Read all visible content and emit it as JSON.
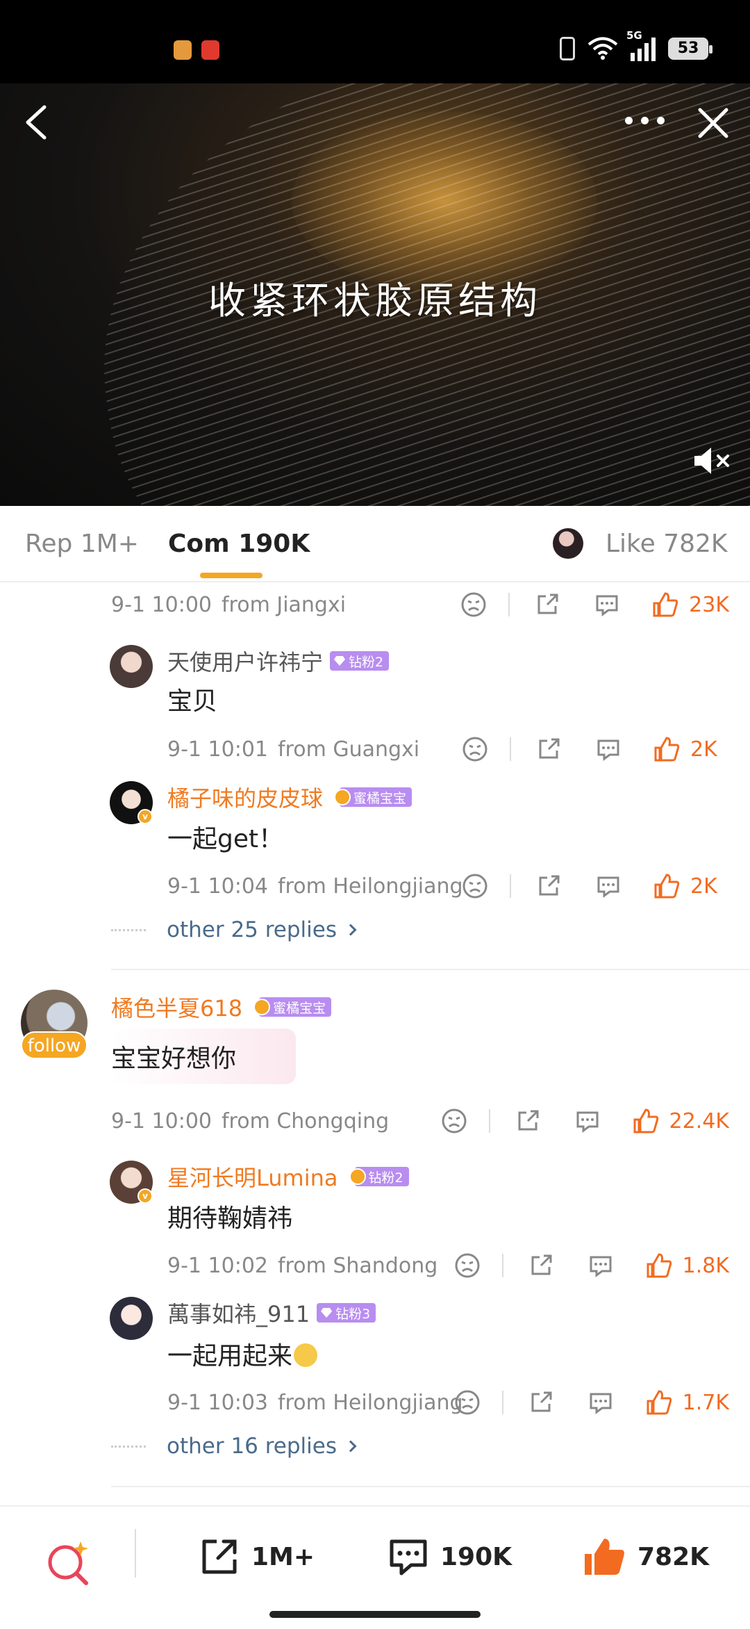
{
  "status_bar": {
    "battery": "53",
    "network": "5G"
  },
  "video": {
    "caption": "收紧环状胶原结构",
    "back_icon": "chevron-left-icon",
    "more_icon": "ellipsis-icon",
    "close_icon": "close-icon",
    "mute_icon": "muted-speaker-icon"
  },
  "tabs": [
    {
      "label": "Rep 1M+"
    },
    {
      "label": "Com 190K",
      "active": true
    },
    {
      "label": "Like 782K"
    }
  ],
  "colors": {
    "accent": "#f5a623",
    "like": "#f26b21",
    "link": "#4a6a8a",
    "badge": "#b88df0"
  },
  "comments": {
    "top_meta": {
      "time": "9-1 10:00",
      "location": "from Jiangxi",
      "likes": "23K"
    },
    "replies_1": [
      {
        "user": "天使用户许祎宁",
        "badge": "钻粉2",
        "text": "宝贝",
        "time": "9-1 10:01",
        "location": "from Guangxi",
        "likes": "2K"
      },
      {
        "user": "橘子味的皮皮球",
        "badge": "蜜橘宝宝",
        "text": "一起get！",
        "time": "9-1 10:04",
        "location": "from Heilongjiang",
        "likes": "2K"
      }
    ],
    "more_1": "other 25 replies",
    "main_2": {
      "user": "橘色半夏618",
      "badge": "蜜橘宝宝",
      "follow": "follow",
      "text": "宝宝好想你",
      "time": "9-1 10:00",
      "location": "from Chongqing",
      "likes": "22.4K"
    },
    "replies_2": [
      {
        "user": "星河长明Lumina",
        "badge": "钻粉2",
        "text": "期待鞠婧祎",
        "time": "9-1 10:02",
        "location": "from Shandong",
        "likes": "1.8K"
      },
      {
        "user": "萬事如祎_911",
        "badge": "钻粉3",
        "text": "一起用起来",
        "time": "9-1 10:03",
        "location": "from Heilongjiang",
        "likes": "1.7K"
      }
    ],
    "more_2": "other 16 replies"
  },
  "bottom_bar": {
    "repost": "1M+",
    "comments": "190K",
    "likes": "782K"
  }
}
